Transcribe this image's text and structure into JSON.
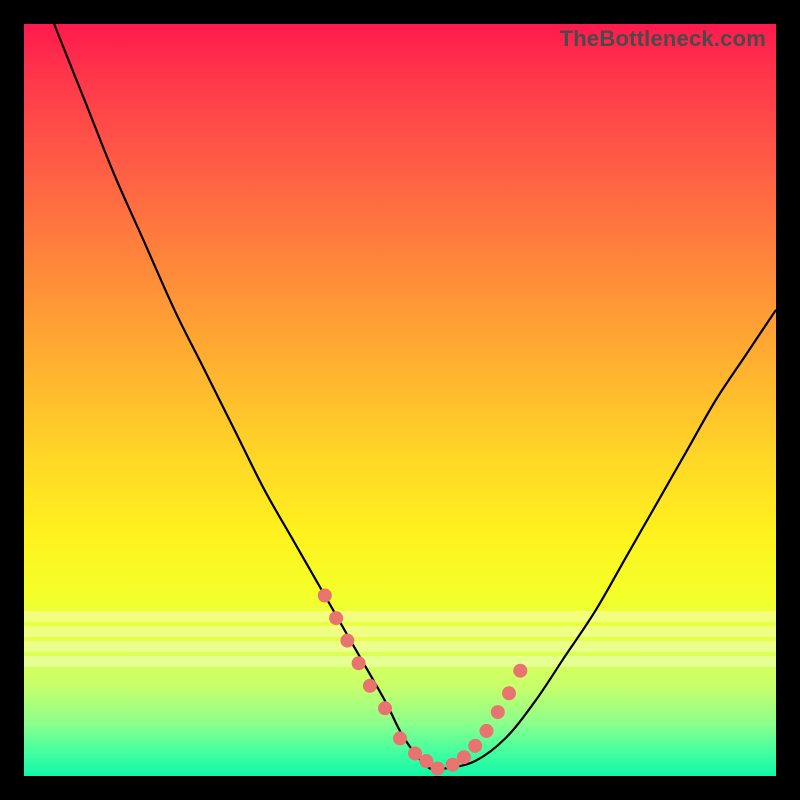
{
  "watermark": "TheBottleneck.com",
  "colors": {
    "frame_bg_top": "#ff1a4d",
    "frame_bg_bottom": "#10f8a8",
    "curve": "#000000",
    "dots": "#e9736f",
    "page_bg": "#000000"
  },
  "chart_data": {
    "type": "line",
    "title": "",
    "xlabel": "",
    "ylabel": "",
    "xlim": [
      0,
      100
    ],
    "ylim": [
      0,
      100
    ],
    "grid": false,
    "legend": false,
    "notes": "No axes, ticks, or labels are rendered; y represents bottleneck percentage (high at top red, low near bottom green). Values are read from pixel positions relative to the 752×752 plot area.",
    "series": [
      {
        "name": "bottleneck-curve",
        "x": [
          4,
          8,
          12,
          16,
          20,
          24,
          28,
          32,
          36,
          40,
          44,
          48,
          50,
          52,
          54,
          56,
          60,
          64,
          68,
          72,
          76,
          80,
          84,
          88,
          92,
          96,
          100
        ],
        "y": [
          100,
          90,
          80,
          71,
          62,
          54,
          46,
          38,
          31,
          24,
          17,
          10,
          6,
          3,
          1,
          1,
          2,
          5,
          10,
          16,
          22,
          29,
          36,
          43,
          50,
          56,
          62
        ]
      }
    ],
    "highlight_points": {
      "name": "near-optimum-dots",
      "x": [
        40.0,
        41.5,
        43.0,
        44.5,
        46.0,
        48.0,
        50.0,
        52.0,
        53.5,
        55.0,
        57.0,
        58.5,
        60.0,
        61.5,
        63.0,
        64.5,
        66.0
      ],
      "y": [
        24.0,
        21.0,
        18.0,
        15.0,
        12.0,
        9.0,
        5.0,
        3.0,
        2.0,
        1.0,
        1.5,
        2.5,
        4.0,
        6.0,
        8.5,
        11.0,
        14.0
      ]
    },
    "fade_bands_y": [
      78,
      80,
      82,
      84
    ]
  }
}
